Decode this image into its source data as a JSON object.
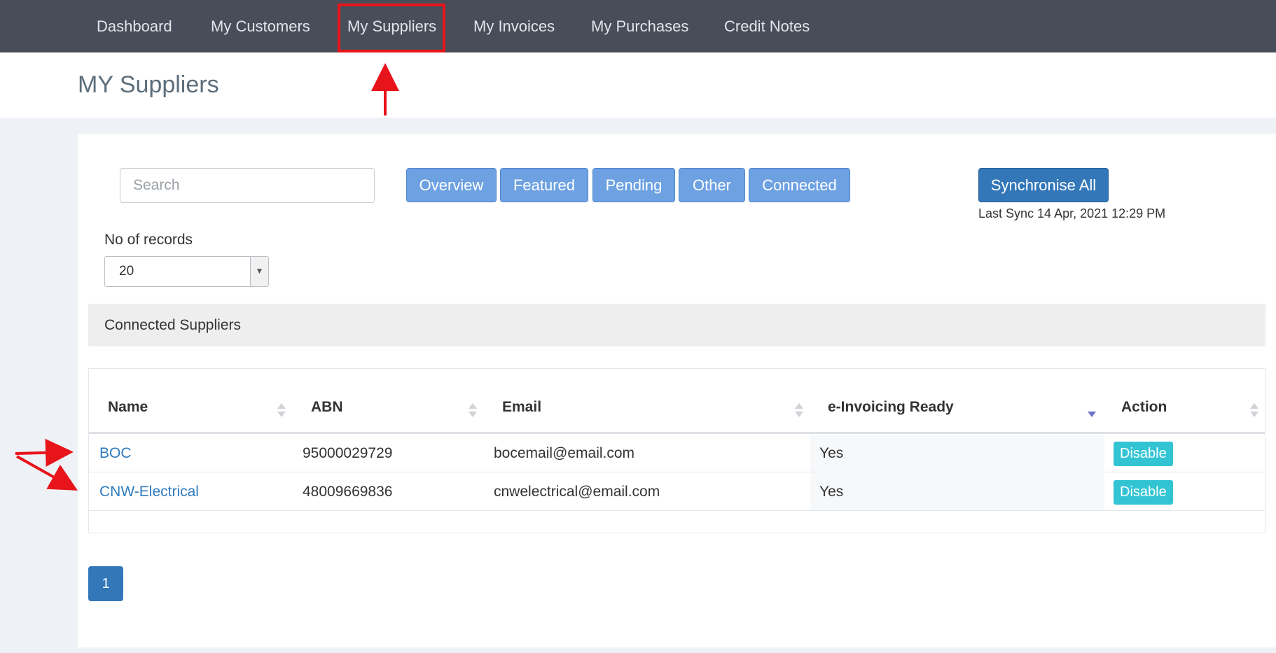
{
  "nav": {
    "items": [
      {
        "label": "Dashboard"
      },
      {
        "label": "My Customers"
      },
      {
        "label": "My Suppliers"
      },
      {
        "label": "My Invoices"
      },
      {
        "label": "My Purchases"
      },
      {
        "label": "Credit Notes"
      }
    ],
    "active_index": 2
  },
  "page": {
    "title": "MY Suppliers"
  },
  "search": {
    "placeholder": "Search",
    "value": ""
  },
  "filters": [
    {
      "label": "Overview"
    },
    {
      "label": "Featured"
    },
    {
      "label": "Pending"
    },
    {
      "label": "Other"
    },
    {
      "label": "Connected"
    }
  ],
  "sync": {
    "button_label": "Synchronise All",
    "last_sync": "Last Sync 14 Apr, 2021 12:29 PM"
  },
  "records": {
    "label": "No of records",
    "selected": "20"
  },
  "section": {
    "title": "Connected Suppliers"
  },
  "table": {
    "columns": [
      "Name",
      "ABN",
      "Email",
      "e-Invoicing Ready",
      "Action"
    ],
    "sorted_column": "e-Invoicing Ready",
    "sort_direction": "descending",
    "rows": [
      {
        "name": "BOC",
        "abn": "95000029729",
        "email": "bocemail@email.com",
        "einvoicing": "Yes",
        "action": "Disable"
      },
      {
        "name": "CNW-Electrical",
        "abn": "48009669836",
        "email": "cnwelectrical@email.com",
        "einvoicing": "Yes",
        "action": "Disable"
      }
    ]
  },
  "pagination": {
    "current": "1"
  },
  "colors": {
    "nav_bg": "#474e59",
    "filter_button": "#6da1e2",
    "primary_button": "#3477b9",
    "disable_button": "#33c4d3",
    "link": "#2f7bbd",
    "annotation": "#e8141b"
  }
}
